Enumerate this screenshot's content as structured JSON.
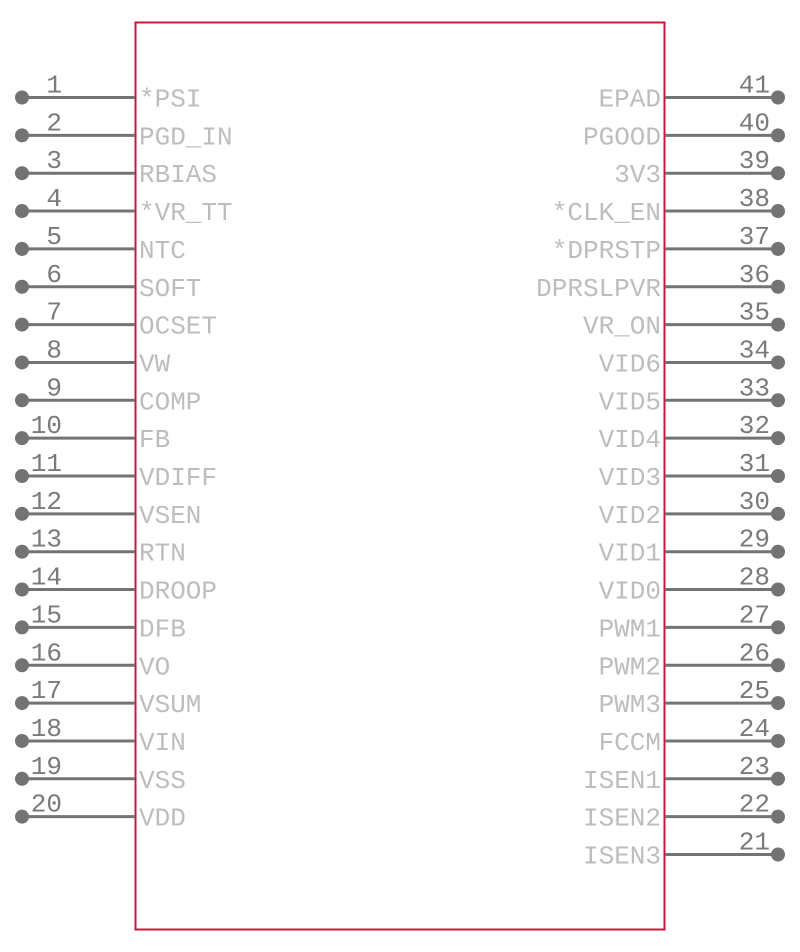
{
  "colors": {
    "body_outline": "#c8193c",
    "pin": "#737373",
    "pin_number": "#7a7a7a",
    "pin_label": "#bdbdbd"
  },
  "left_pins": [
    {
      "number": "1",
      "name": "*PSI"
    },
    {
      "number": "2",
      "name": "PGD_IN"
    },
    {
      "number": "3",
      "name": "RBIAS"
    },
    {
      "number": "4",
      "name": "*VR_TT"
    },
    {
      "number": "5",
      "name": "NTC"
    },
    {
      "number": "6",
      "name": "SOFT"
    },
    {
      "number": "7",
      "name": "OCSET"
    },
    {
      "number": "8",
      "name": "VW"
    },
    {
      "number": "9",
      "name": "COMP"
    },
    {
      "number": "10",
      "name": "FB"
    },
    {
      "number": "11",
      "name": "VDIFF"
    },
    {
      "number": "12",
      "name": "VSEN"
    },
    {
      "number": "13",
      "name": "RTN"
    },
    {
      "number": "14",
      "name": "DROOP"
    },
    {
      "number": "15",
      "name": "DFB"
    },
    {
      "number": "16",
      "name": "VO"
    },
    {
      "number": "17",
      "name": "VSUM"
    },
    {
      "number": "18",
      "name": "VIN"
    },
    {
      "number": "19",
      "name": "VSS"
    },
    {
      "number": "20",
      "name": "VDD"
    }
  ],
  "right_pins": [
    {
      "number": "41",
      "name": "EPAD"
    },
    {
      "number": "40",
      "name": "PGOOD"
    },
    {
      "number": "39",
      "name": "3V3"
    },
    {
      "number": "38",
      "name": "*CLK_EN"
    },
    {
      "number": "37",
      "name": "*DPRSTP"
    },
    {
      "number": "36",
      "name": "DPRSLPVR"
    },
    {
      "number": "35",
      "name": "VR_ON"
    },
    {
      "number": "34",
      "name": "VID6"
    },
    {
      "number": "33",
      "name": "VID5"
    },
    {
      "number": "32",
      "name": "VID4"
    },
    {
      "number": "31",
      "name": "VID3"
    },
    {
      "number": "30",
      "name": "VID2"
    },
    {
      "number": "29",
      "name": "VID1"
    },
    {
      "number": "28",
      "name": "VID0"
    },
    {
      "number": "27",
      "name": "PWM1"
    },
    {
      "number": "26",
      "name": "PWM2"
    },
    {
      "number": "25",
      "name": "PWM3"
    },
    {
      "number": "24",
      "name": "FCCM"
    },
    {
      "number": "23",
      "name": "ISEN1"
    },
    {
      "number": "22",
      "name": "ISEN2"
    },
    {
      "number": "21",
      "name": "ISEN3"
    }
  ]
}
